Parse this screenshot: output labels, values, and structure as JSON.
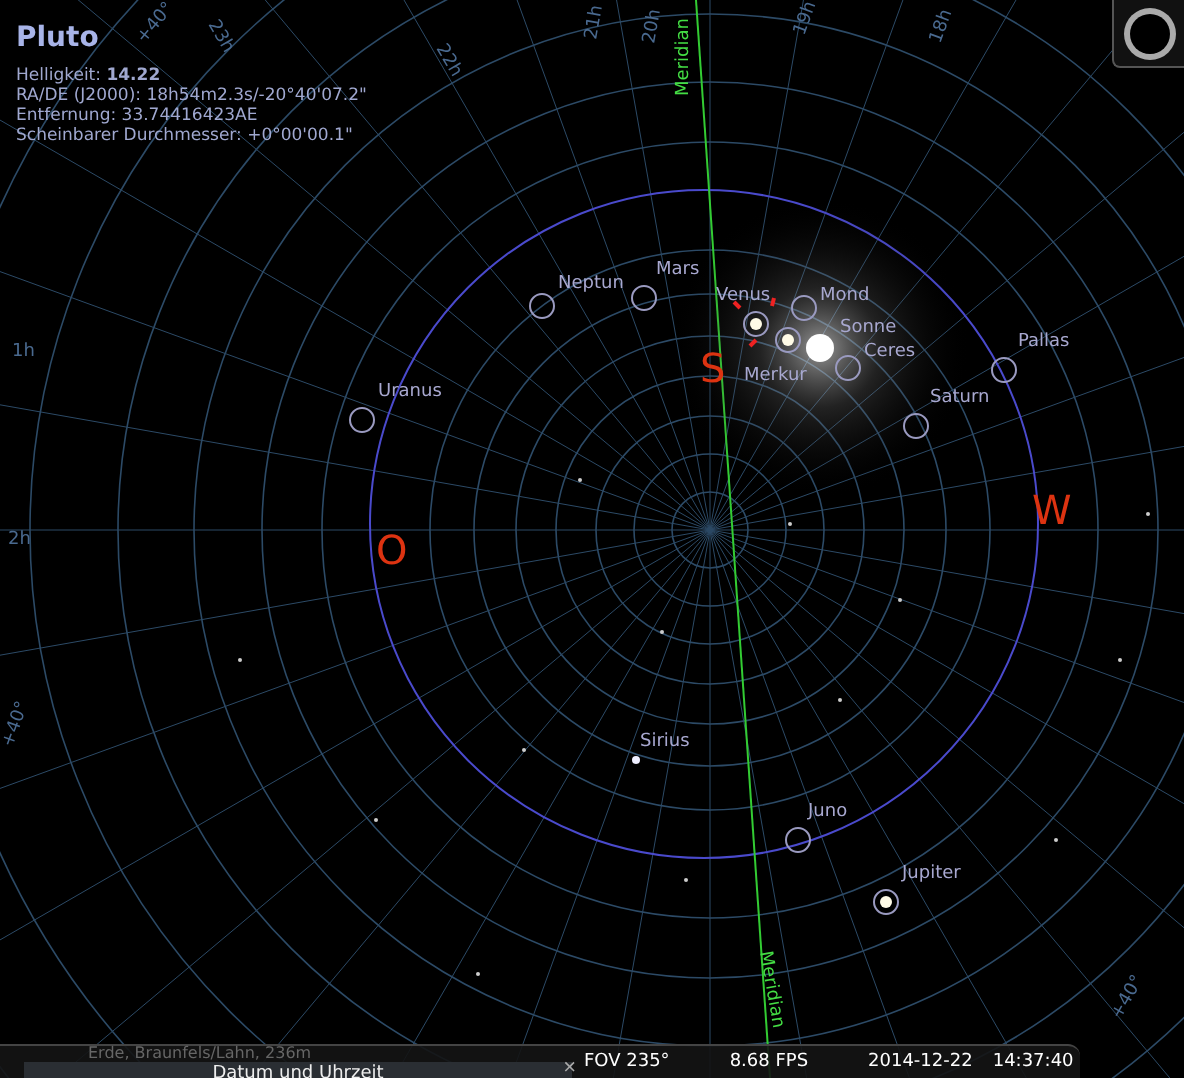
{
  "info": {
    "title": "Pluto",
    "lines": [
      "Helligkeit: **14.22**",
      "RA/DE (J2000): 18h54m2.3s/-20°40'07.2\"",
      "Entfernung: 33.74416423AE",
      "Scheinbarer Durchmesser: +0°00'00.1\""
    ]
  },
  "grid_labels": [
    "+40°",
    "23h",
    "22h",
    "21h",
    "20h",
    "19h",
    "18h",
    "1h",
    "2h",
    "+40°",
    "+40°"
  ],
  "meridian_labels": [
    "Meridian",
    "Meridian"
  ],
  "cardinals": [
    "S",
    "O",
    "W"
  ],
  "objects": [
    {
      "name": "Neptun",
      "kind": "planet"
    },
    {
      "name": "Mars",
      "kind": "planet"
    },
    {
      "name": "Venus",
      "kind": "bright"
    },
    {
      "name": "Merkur",
      "kind": "bright"
    },
    {
      "name": "Mond",
      "kind": "planet"
    },
    {
      "name": "Sonne",
      "kind": "sun"
    },
    {
      "name": "Ceres",
      "kind": "planet"
    },
    {
      "name": "Pallas",
      "kind": "planet"
    },
    {
      "name": "Saturn",
      "kind": "planet"
    },
    {
      "name": "Uranus",
      "kind": "planet"
    },
    {
      "name": "Sirius",
      "kind": "star"
    },
    {
      "name": "Juno",
      "kind": "planet"
    },
    {
      "name": "Jupiter",
      "kind": "bright"
    }
  ],
  "status": {
    "location": "Erde, Braunfels/Lahn, 236m",
    "fov": "FOV 235°",
    "fps": "8.68 FPS",
    "date": "2014-12-22",
    "time": "14:37:40"
  },
  "dialog": {
    "title": "Datum und Uhrzeit",
    "close": "×"
  }
}
